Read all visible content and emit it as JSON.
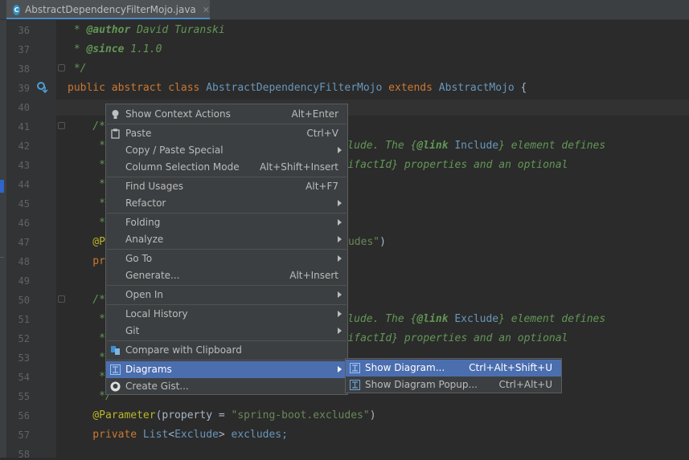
{
  "tab": {
    "filename": "AbstractDependencyFilterMojo.java",
    "icon_letter": "C",
    "close": "✕"
  },
  "lines": [
    {
      "no": "36"
    },
    {
      "no": "37"
    },
    {
      "no": "38"
    },
    {
      "no": "39"
    },
    {
      "no": "40"
    },
    {
      "no": "41"
    },
    {
      "no": "42"
    },
    {
      "no": "43"
    },
    {
      "no": "44"
    },
    {
      "no": "45"
    },
    {
      "no": "46"
    },
    {
      "no": "47"
    },
    {
      "no": "48"
    },
    {
      "no": "49"
    },
    {
      "no": "50"
    },
    {
      "no": "51"
    },
    {
      "no": "52"
    },
    {
      "no": "53"
    },
    {
      "no": "54"
    },
    {
      "no": "55"
    },
    {
      "no": "56"
    },
    {
      "no": "57"
    },
    {
      "no": "58"
    }
  ],
  "code": {
    "l36_pre": " * ",
    "l36_tag": "@author",
    "l36_val": " David Turanski",
    "l37_pre": " * ",
    "l37_tag": "@since",
    "l37_val": " 1.1.0",
    "l38": " */",
    "l39_kw": "public abstract class ",
    "l39_cls": "AbstractDependencyFilterMojo",
    "l39_kw2": " extends ",
    "l39_cls2": "AbstractMojo",
    "l39_brace": " {",
    "l41": "    /*",
    "l42_a": "     *",
    "l42_b": " include. The {",
    "l42_tag": "@link",
    "l42_cls": " Include",
    "l42_c": "} element defines",
    "l43_a": "     *",
    "l43_b": "artifactId} properties and an optional",
    "l44": "     *",
    "l45": "     *",
    "l46": "     *",
    "l47_ann": "    @P",
    "l47_str": "udes\"",
    "l47_end": ")",
    "l48": "    pr",
    "l50": "    /*",
    "l51_a": "     *",
    "l51_b": " exclude. The {",
    "l51_tag": "@link",
    "l51_cls": " Exclude",
    "l51_c": "} element defines",
    "l52_a": "     *",
    "l52_b": "artifactId} properties and an optional",
    "l53": "     *",
    "l54": "     *",
    "l55": "     */",
    "l56_ann": "    @Parameter",
    "l56_mid": "(property = ",
    "l56_str": "\"spring-boot.excludes\"",
    "l56_end": ")",
    "l57_kw": "    private ",
    "l57_type": "List",
    "l57_lt": "<",
    "l57_cls": "Exclude",
    "l57_gt": "> ",
    "l57_var": "excludes;"
  },
  "context_menu": {
    "items": [
      {
        "label": "Show Context Actions",
        "shortcut": "Alt+Enter",
        "icon": "lightbulb-icon"
      },
      {
        "label": "Paste",
        "shortcut": "Ctrl+V",
        "icon": "paste-icon"
      },
      {
        "label": "Copy / Paste Special",
        "shortcut": "",
        "submenu": true
      },
      {
        "label": "Column Selection Mode",
        "shortcut": "Alt+Shift+Insert"
      },
      {
        "label": "Find Usages",
        "shortcut": "Alt+F7"
      },
      {
        "label": "Refactor",
        "shortcut": "",
        "submenu": true
      },
      {
        "label": "Folding",
        "shortcut": "",
        "submenu": true
      },
      {
        "label": "Analyze",
        "shortcut": "",
        "submenu": true
      },
      {
        "label": "Go To",
        "shortcut": "",
        "submenu": true
      },
      {
        "label": "Generate...",
        "shortcut": "Alt+Insert"
      },
      {
        "label": "Open In",
        "shortcut": "",
        "submenu": true
      },
      {
        "label": "Local History",
        "shortcut": "",
        "submenu": true
      },
      {
        "label": "Git",
        "shortcut": "",
        "submenu": true
      },
      {
        "label": "Compare with Clipboard",
        "shortcut": "",
        "icon": "compare-icon"
      },
      {
        "label": "Diagrams",
        "shortcut": "",
        "submenu": true,
        "selected": true,
        "icon": "diagram-icon"
      },
      {
        "label": "Create Gist...",
        "shortcut": "",
        "icon": "github-icon"
      }
    ]
  },
  "submenu": {
    "items": [
      {
        "label": "Show Diagram...",
        "shortcut": "Ctrl+Alt+Shift+U",
        "selected": true
      },
      {
        "label": "Show Diagram Popup...",
        "shortcut": "Ctrl+Alt+U"
      }
    ]
  },
  "colors": {
    "background": "#2b2b2b",
    "menu_bg": "#3c3f41",
    "selection": "#4b6eaf",
    "keyword": "#cc7832",
    "string": "#6a8759",
    "comment": "#629755"
  }
}
